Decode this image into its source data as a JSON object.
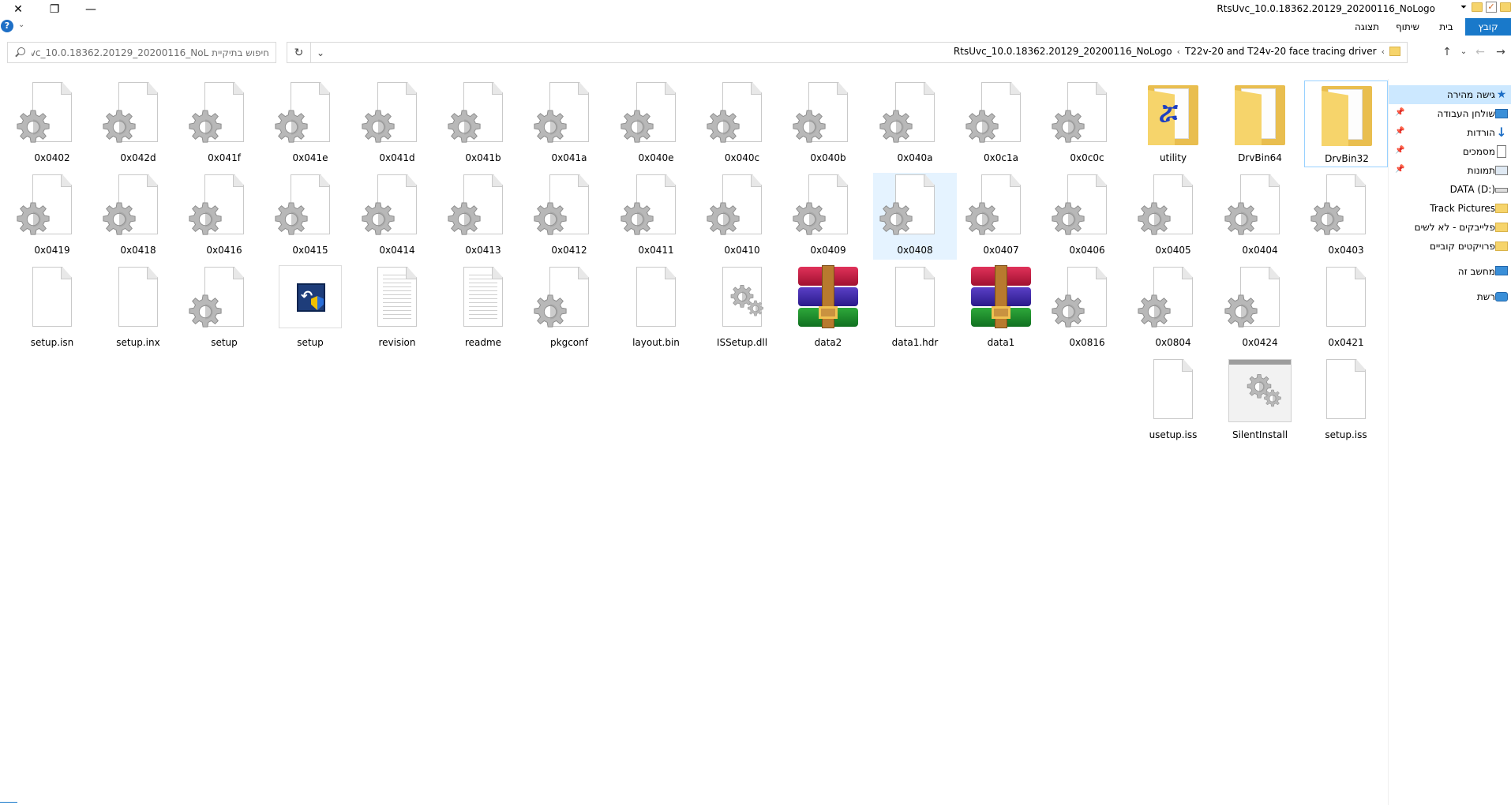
{
  "window": {
    "title": "RtsUvc_10.0.18362.20129_20200116_NoLogo"
  },
  "ribbon": {
    "tabs": [
      {
        "id": "file",
        "label": "קובץ"
      },
      {
        "id": "home",
        "label": "בית"
      },
      {
        "id": "share",
        "label": "שיתוף"
      },
      {
        "id": "view",
        "label": "תצוגה"
      }
    ],
    "help_icon": "help-icon",
    "accent_color": "#1979ca"
  },
  "address": {
    "breadcrumb": [
      "T22v-20 and T24v-20 face tracing driver",
      "RtsUvc_10.0.18362.20129_20200116_NoLogo"
    ],
    "search_placeholder": "חיפוש בתיקיית RtsUvc_10.0.18362.20129_20200116_NoL..."
  },
  "navpane": {
    "items": [
      {
        "label": "גישה מהירה",
        "icon": "star-icon",
        "selected": true,
        "pinned": false
      },
      {
        "label": "שולחן העבודה",
        "icon": "desktop-icon",
        "pinned": true
      },
      {
        "label": "הורדות",
        "icon": "download-icon",
        "pinned": true
      },
      {
        "label": "מסמכים",
        "icon": "documents-icon",
        "pinned": true
      },
      {
        "label": "תמונות",
        "icon": "pictures-icon",
        "pinned": true
      },
      {
        "label": "DATA (D:)",
        "icon": "drive-icon",
        "pinned": false
      },
      {
        "label": "Track Pictures",
        "icon": "folder-icon",
        "pinned": false
      },
      {
        "label": "פלייבקים - לא לשים",
        "icon": "folder-icon",
        "pinned": false
      },
      {
        "label": "פרויקטים קוביים",
        "icon": "folder-icon",
        "pinned": false
      },
      {
        "label": "מחשב זה",
        "icon": "computer-icon",
        "pinned": false
      },
      {
        "label": "רשת",
        "icon": "network-icon",
        "pinned": false
      }
    ]
  },
  "files": {
    "row1": [
      {
        "name": "DrvBin32",
        "type": "folder",
        "selected": true
      },
      {
        "name": "DrvBin64",
        "type": "folder"
      },
      {
        "name": "utility",
        "type": "folder-utility"
      },
      {
        "name": "0x0c0c",
        "type": "config"
      },
      {
        "name": "0x0c1a",
        "type": "config"
      },
      {
        "name": "0x040a",
        "type": "config"
      },
      {
        "name": "0x040b",
        "type": "config"
      },
      {
        "name": "0x040c",
        "type": "config"
      },
      {
        "name": "0x040e",
        "type": "config"
      },
      {
        "name": "0x041a",
        "type": "config"
      },
      {
        "name": "0x041b",
        "type": "config"
      },
      {
        "name": "0x041d",
        "type": "config"
      },
      {
        "name": "0x041e",
        "type": "config"
      },
      {
        "name": "0x041f",
        "type": "config"
      },
      {
        "name": "0x042d",
        "type": "config"
      },
      {
        "name": "0x0402",
        "type": "config"
      }
    ],
    "row2": [
      {
        "name": "0x0403",
        "type": "config"
      },
      {
        "name": "0x0404",
        "type": "config"
      },
      {
        "name": "0x0405",
        "type": "config"
      },
      {
        "name": "0x0406",
        "type": "config"
      },
      {
        "name": "0x0407",
        "type": "config"
      },
      {
        "name": "0x0408",
        "type": "config",
        "hover": true
      },
      {
        "name": "0x0409",
        "type": "config"
      },
      {
        "name": "0x0410",
        "type": "config"
      },
      {
        "name": "0x0411",
        "type": "config"
      },
      {
        "name": "0x0412",
        "type": "config"
      },
      {
        "name": "0x0413",
        "type": "config"
      },
      {
        "name": "0x0414",
        "type": "config"
      },
      {
        "name": "0x0415",
        "type": "config"
      },
      {
        "name": "0x0416",
        "type": "config"
      },
      {
        "name": "0x0418",
        "type": "config"
      },
      {
        "name": "0x0419",
        "type": "config"
      }
    ],
    "row3": [
      {
        "name": "0x0421",
        "type": "blank"
      },
      {
        "name": "0x0424",
        "type": "config"
      },
      {
        "name": "0x0804",
        "type": "config"
      },
      {
        "name": "0x0816",
        "type": "config"
      },
      {
        "name": "data1",
        "type": "winrar"
      },
      {
        "name": "data1.hdr",
        "type": "blank"
      },
      {
        "name": "data2",
        "type": "winrar"
      },
      {
        "name": "ISSetup.dll",
        "type": "dll"
      },
      {
        "name": "layout.bin",
        "type": "blank"
      },
      {
        "name": "pkgconf",
        "type": "config"
      },
      {
        "name": "readme",
        "type": "text"
      },
      {
        "name": "revision",
        "type": "text"
      },
      {
        "name": "setup",
        "type": "installer"
      },
      {
        "name": "setup",
        "type": "config"
      },
      {
        "name": "setup.inx",
        "type": "blank"
      },
      {
        "name": "setup.isn",
        "type": "blank"
      }
    ],
    "row4": [
      {
        "name": "setup.iss",
        "type": "blank"
      },
      {
        "name": "SilentInstall",
        "type": "silent"
      },
      {
        "name": "usetup.iss",
        "type": "blank"
      }
    ]
  }
}
